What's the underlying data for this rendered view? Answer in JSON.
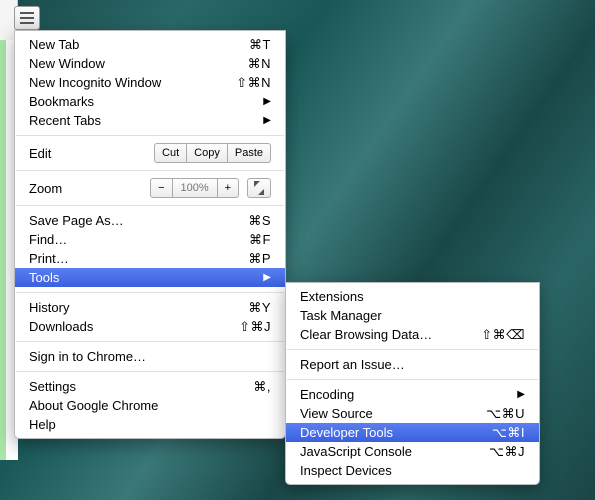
{
  "main_menu": {
    "new_tab": {
      "label": "New Tab",
      "shortcut": "⌘T"
    },
    "new_window": {
      "label": "New Window",
      "shortcut": "⌘N"
    },
    "new_incognito": {
      "label": "New Incognito Window",
      "shortcut": "⇧⌘N"
    },
    "bookmarks": {
      "label": "Bookmarks"
    },
    "recent_tabs": {
      "label": "Recent Tabs"
    },
    "edit": {
      "label": "Edit",
      "cut": "Cut",
      "copy": "Copy",
      "paste": "Paste"
    },
    "zoom": {
      "label": "Zoom",
      "minus": "−",
      "value": "100%",
      "plus": "+"
    },
    "save_page": {
      "label": "Save Page As…",
      "shortcut": "⌘S"
    },
    "find": {
      "label": "Find…",
      "shortcut": "⌘F"
    },
    "print": {
      "label": "Print…",
      "shortcut": "⌘P"
    },
    "tools": {
      "label": "Tools"
    },
    "history": {
      "label": "History",
      "shortcut": "⌘Y"
    },
    "downloads": {
      "label": "Downloads",
      "shortcut": "⇧⌘J"
    },
    "signin": {
      "label": "Sign in to Chrome…"
    },
    "settings": {
      "label": "Settings",
      "shortcut": "⌘,"
    },
    "about": {
      "label": "About Google Chrome"
    },
    "help": {
      "label": "Help"
    }
  },
  "tools_submenu": {
    "extensions": {
      "label": "Extensions"
    },
    "task_manager": {
      "label": "Task Manager"
    },
    "clear_browsing": {
      "label": "Clear Browsing Data…",
      "shortcut": "⇧⌘⌫"
    },
    "report_issue": {
      "label": "Report an Issue…"
    },
    "encoding": {
      "label": "Encoding"
    },
    "view_source": {
      "label": "View Source",
      "shortcut": "⌥⌘U"
    },
    "developer_tools": {
      "label": "Developer Tools",
      "shortcut": "⌥⌘I"
    },
    "js_console": {
      "label": "JavaScript Console",
      "shortcut": "⌥⌘J"
    },
    "inspect_devices": {
      "label": "Inspect Devices"
    }
  }
}
